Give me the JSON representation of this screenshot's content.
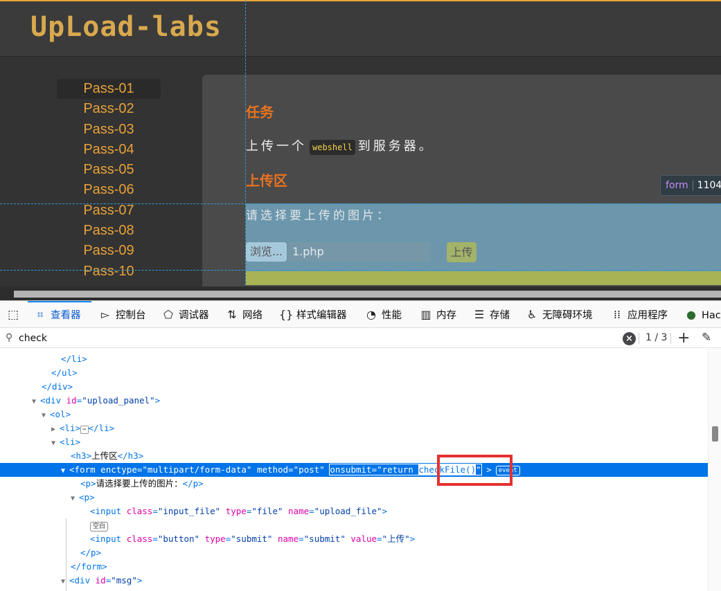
{
  "page": {
    "logo": "UpLoad-labs",
    "sidebar": [
      "Pass-01",
      "Pass-02",
      "Pass-03",
      "Pass-04",
      "Pass-05",
      "Pass-06",
      "Pass-07",
      "Pass-08",
      "Pass-09",
      "Pass-10"
    ],
    "task_heading": "任务",
    "task_pre": "上传一个",
    "task_code": "webshell",
    "task_post": "到服务器。",
    "upload_heading": "上传区",
    "form_label": "请选择要上传的图片：",
    "browse_label": "浏览...",
    "file_name": "1.php",
    "submit_label": "上传",
    "tooltip_tag": "form",
    "tooltip_dims": "1104"
  },
  "devtools": {
    "tabs": [
      "查看器",
      "控制台",
      "调试器",
      "网络",
      "样式编辑器",
      "性能",
      "内存",
      "存储",
      "无障碍环境",
      "应用程序",
      "Hac"
    ],
    "search_value": "check",
    "match_count": "1 / 3",
    "tree": {
      "r1": "</li>",
      "r2": "</ul>",
      "r3": "</div>",
      "r4_tag": "<div",
      "r4_an": "id",
      "r4_av": "\"upload_panel\"",
      "r5": "<ol>",
      "r6_open": "<li>",
      "r6_close": "</li>",
      "r7": "<li>",
      "r8_open": "<h3>",
      "r8_text": "上传区",
      "r8_close": "</h3>",
      "form_tag": "<form",
      "form_a1": "enctype",
      "form_v1": "\"multipart/form-data\"",
      "form_a2": "method",
      "form_v2": "\"post\"",
      "form_a3": "onsubmit",
      "form_v3a": "\"return ",
      "form_v3b": "checkFile()",
      "form_v3c": "\"",
      "form_end": ">",
      "event_badge": "event",
      "r10_open": "<p>",
      "r10_text": "请选择要上传的图片：",
      "r10_close": "</p>",
      "r11": "<p>",
      "r12_tag": "<input",
      "r12_a1": "class",
      "r12_v1": "\"input_file\"",
      "r12_a2": "type",
      "r12_v2": "\"file\"",
      "r12_a3": "name",
      "r12_v3": "\"upload_file\"",
      "r12_end": ">",
      "whitespace_badge": "空白",
      "r14_tag": "<input",
      "r14_a1": "class",
      "r14_v1": "\"button\"",
      "r14_a2": "type",
      "r14_v2": "\"submit\"",
      "r14_a3": "name",
      "r14_v3": "\"submit\"",
      "r14_a4": "value",
      "r14_v4": "\"上传\"",
      "r14_end": ">",
      "r15": "</p>",
      "r16": "</form>",
      "r17_tag": "<div",
      "r17_an": "id",
      "r17_av": "\"msg\"",
      "r17_end": ">"
    }
  },
  "colors": {
    "accent_orange": "#e8731f",
    "sidebar_text": "#e7a139",
    "selection_blue": "#0074e8",
    "highlight_red": "#e53030"
  }
}
